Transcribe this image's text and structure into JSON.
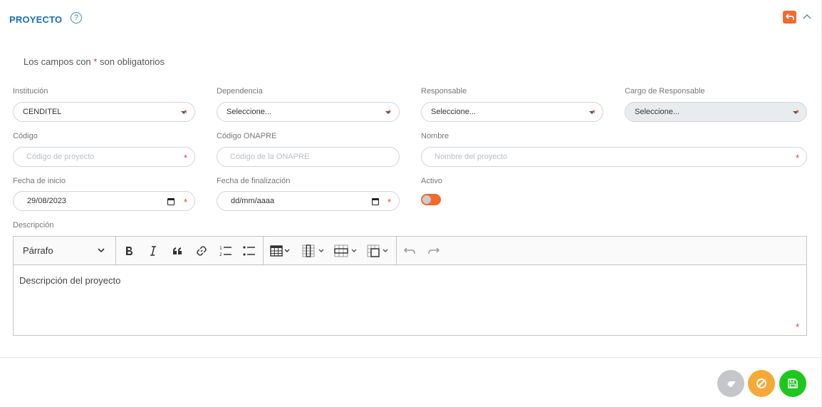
{
  "header": {
    "title": "PROYECTO",
    "help_label": "?"
  },
  "note": {
    "prefix": "Los campos con",
    "asterisk": "*",
    "suffix": "son obligatorios"
  },
  "fields": {
    "institucion": {
      "label": "Institución",
      "value": "CENDITEL"
    },
    "dependencia": {
      "label": "Dependencia",
      "value": "Seleccione..."
    },
    "responsable": {
      "label": "Responsable",
      "value": "Seleccione..."
    },
    "cargo": {
      "label": "Cargo de Responsable",
      "value": "Seleccione..."
    },
    "codigo": {
      "label": "Código",
      "placeholder": "Código de proyecto"
    },
    "codigo_onapre": {
      "label": "Código ONAPRE",
      "placeholder": "Código de la ONAPRE"
    },
    "nombre": {
      "label": "Nombre",
      "placeholder": "Nombre del proyecto"
    },
    "fecha_inicio": {
      "label": "Fecha de inicio",
      "value": "29/08/2023"
    },
    "fecha_fin": {
      "label": "Fecha de finalización",
      "value": "dd/mm/aaaa"
    },
    "activo": {
      "label": "Activo",
      "on": false
    },
    "descripcion": {
      "label": "Descripción",
      "content": "Descripción del proyecto"
    }
  },
  "editor": {
    "block_format": "Párrafo"
  },
  "required_mark": "*",
  "colors": {
    "accent": "#1a6fb5",
    "danger": "#e53935",
    "orange": "#f26a2d",
    "warning": "#f7a937",
    "success": "#1ec71e",
    "muted": "#c4c6c9"
  }
}
